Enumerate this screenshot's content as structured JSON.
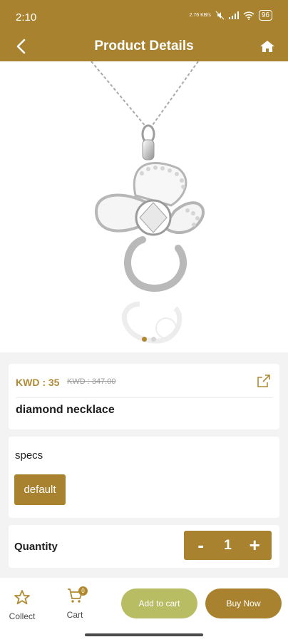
{
  "status_bar": {
    "time": "2:10",
    "speed": "2.76 KB/s",
    "battery": "96"
  },
  "header": {
    "title": "Product Details"
  },
  "product": {
    "price": "KWD : 35",
    "old_price": "KWD : 347.00",
    "name": "diamond necklace"
  },
  "specs": {
    "label": "specs",
    "options": [
      "default"
    ]
  },
  "quantity": {
    "label": "Quantity",
    "minus": "-",
    "value": "1",
    "plus": "+"
  },
  "bottom_bar": {
    "collect_label": "Collect",
    "cart_label": "Cart",
    "cart_count": "0",
    "add_to_cart": "Add to cart",
    "buy_now": "Buy Now"
  },
  "colors": {
    "brand": "#a8822e",
    "add_to_cart": "#b8bc62"
  },
  "icons": [
    "back-arrow-icon",
    "home-icon",
    "share-icon",
    "star-icon",
    "cart-icon"
  ],
  "carousel": {
    "current": 1,
    "total": 2
  }
}
